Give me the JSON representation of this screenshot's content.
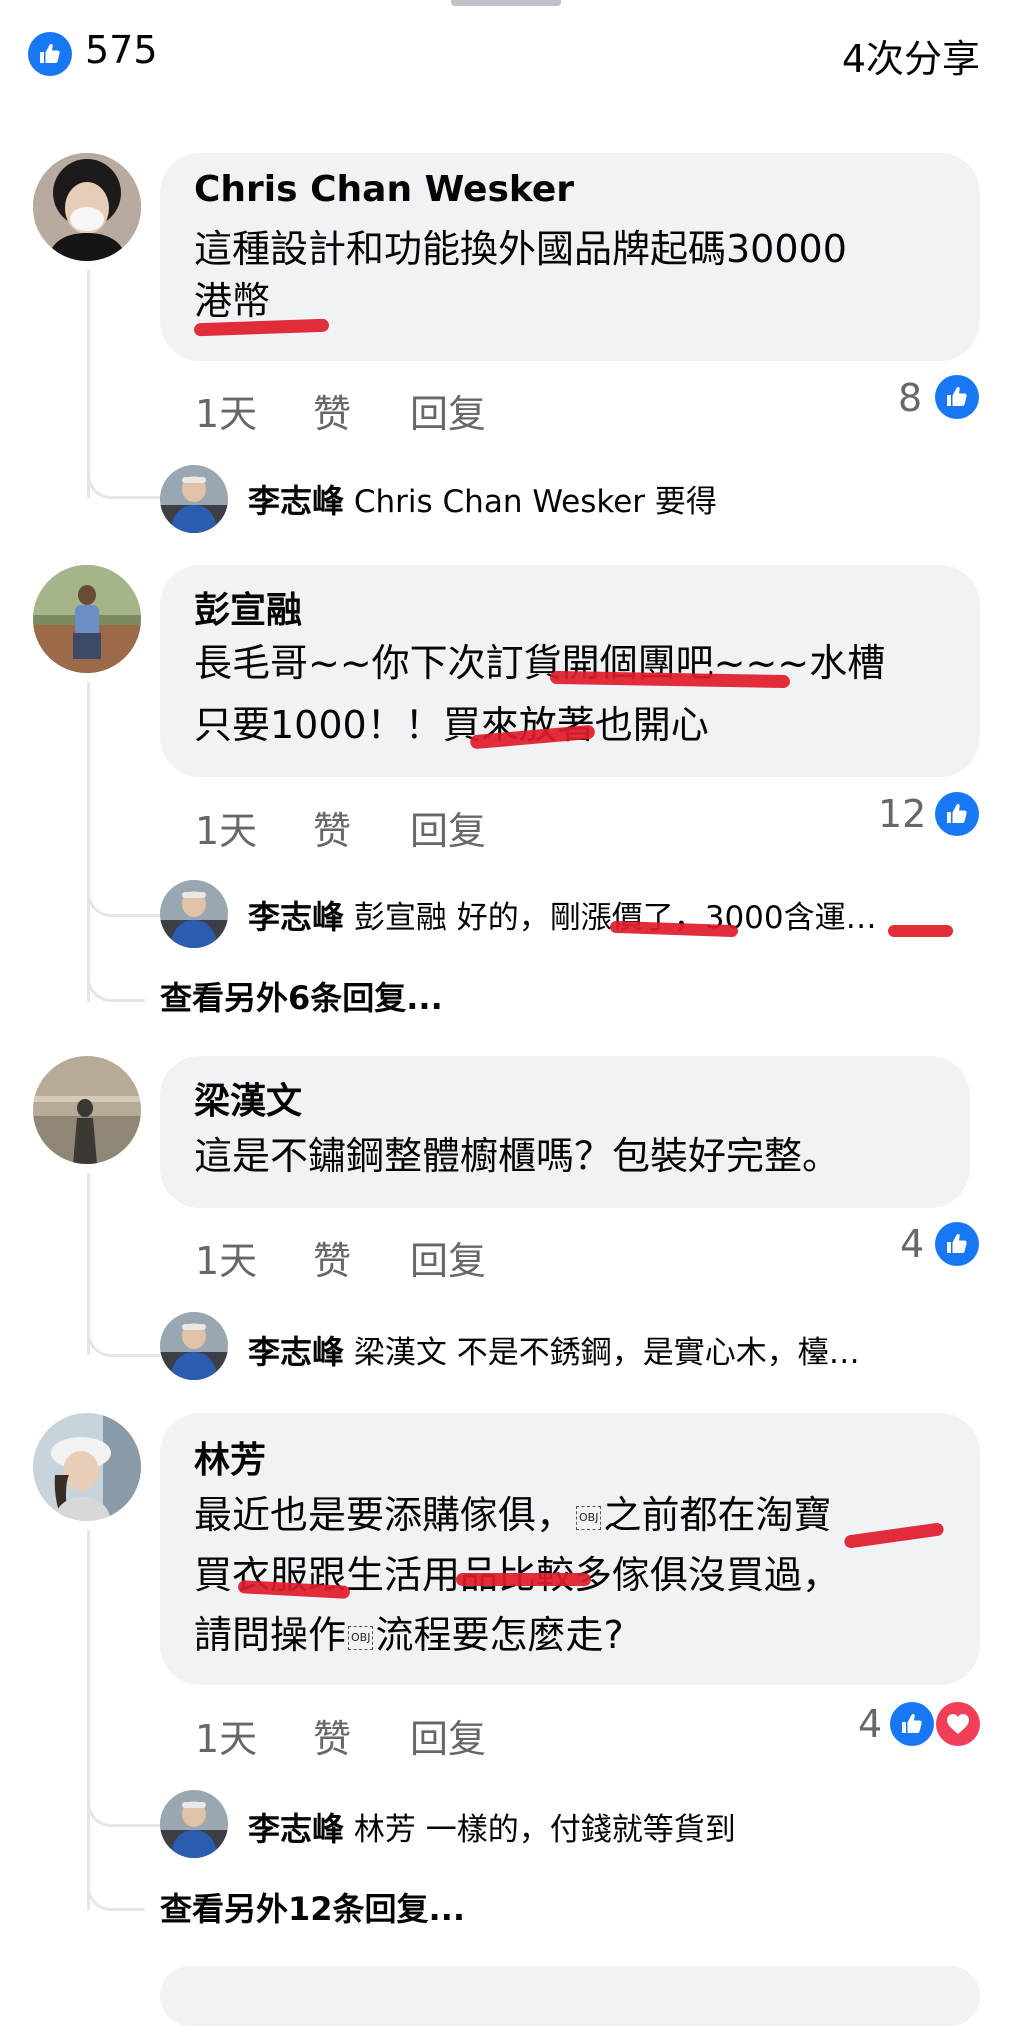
{
  "header": {
    "reaction_count": "575",
    "shares": "4次分享"
  },
  "actions": {
    "time": "1天",
    "like": "赞",
    "reply": "回复"
  },
  "comments": [
    {
      "author": "Chris Chan Wesker",
      "lines": [
        "這種設計和功能換外國品牌起碼30000",
        "港幣"
      ],
      "likes": "8",
      "reply": {
        "author": "李志峰",
        "text": "Chris Chan Wesker 要得"
      }
    },
    {
      "author": "彭宣融",
      "lines": [
        "長毛哥~~你下次訂貨開個團吧~~~水槽",
        "只要1000！！買來放著也開心"
      ],
      "likes": "12",
      "reply": {
        "author": "李志峰",
        "text": "彭宣融 好的，剛漲價了，3000含運…"
      },
      "more_replies": "查看另外6条回复..."
    },
    {
      "author": "梁漢文",
      "lines": [
        "這是不鏽鋼整體櫥櫃嗎？包裝好完整。"
      ],
      "likes": "4",
      "reply": {
        "author": "李志峰",
        "text": "梁漢文 不是不銹鋼，是實心木，檯…"
      }
    },
    {
      "author": "林芳",
      "lines": [
        "最近也是要添購傢俱，",
        "之前都在淘寶",
        "買衣服跟生活用品比較多傢俱沒買過，",
        "請問操作",
        "流程要怎麼走?"
      ],
      "obj_label": "OBJ",
      "likes": "4",
      "reply": {
        "author": "李志峰",
        "text": "林芳 一樣的，付錢就等貨到"
      },
      "more_replies": "查看另外12条回复..."
    }
  ],
  "icons": [
    "like-icon",
    "heart-icon"
  ],
  "colors": {
    "like_blue": "#1877f2",
    "heart_red": "#f33e58",
    "bubble": "#f0f2f5",
    "meta_gray": "#65676b"
  }
}
